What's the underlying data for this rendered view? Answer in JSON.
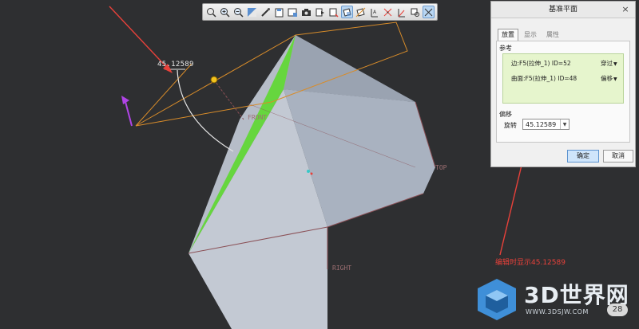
{
  "toolbar": {
    "buttons": [
      {
        "icon": "zoom-fit-icon"
      },
      {
        "icon": "zoom-in-icon"
      },
      {
        "icon": "zoom-out-icon"
      },
      {
        "icon": "view-orient-icon"
      },
      {
        "icon": "shade-icon"
      },
      {
        "icon": "saved-view-icon"
      },
      {
        "icon": "display-style-icon"
      },
      {
        "icon": "camera-icon"
      },
      {
        "icon": "spin-center-icon"
      },
      {
        "icon": "view-manager-icon"
      },
      {
        "icon": "plane-display-icon"
      },
      {
        "icon": "axis-display-icon"
      },
      {
        "icon": "point-display-icon"
      },
      {
        "icon": "csys-display-icon"
      },
      {
        "icon": "annotation-display-icon"
      },
      {
        "icon": "more-icon"
      }
    ]
  },
  "dialog": {
    "title": "基准平面",
    "close": "×",
    "tabs": [
      "放置",
      "显示",
      "属性"
    ],
    "references_label": "参考",
    "references": [
      {
        "text": "边:F5(拉伸_1) ID=52",
        "constraint": "穿过"
      },
      {
        "text": "曲面:F5(拉伸_1) ID=48",
        "constraint": "偏移"
      }
    ],
    "offset_label": "偏移",
    "rotation_label": "旋转",
    "rotation_value": "45.12589",
    "ok_button": "确定",
    "cancel_button": "取消"
  },
  "viewport": {
    "dimension_label": "45.12589",
    "planes": [
      "FRONT",
      "TOP",
      "RIGHT"
    ],
    "annotation_text": "编辑时显示45.12589"
  },
  "watermark": {
    "text": "3D世界网",
    "url": "WWW.3DSJW.COM",
    "badge": "28"
  },
  "colors": {
    "background": "#2e2f31",
    "highlight_green": "#5fd832",
    "annotation_red": "#e8413a",
    "plane_outline": "#d88c2a"
  }
}
